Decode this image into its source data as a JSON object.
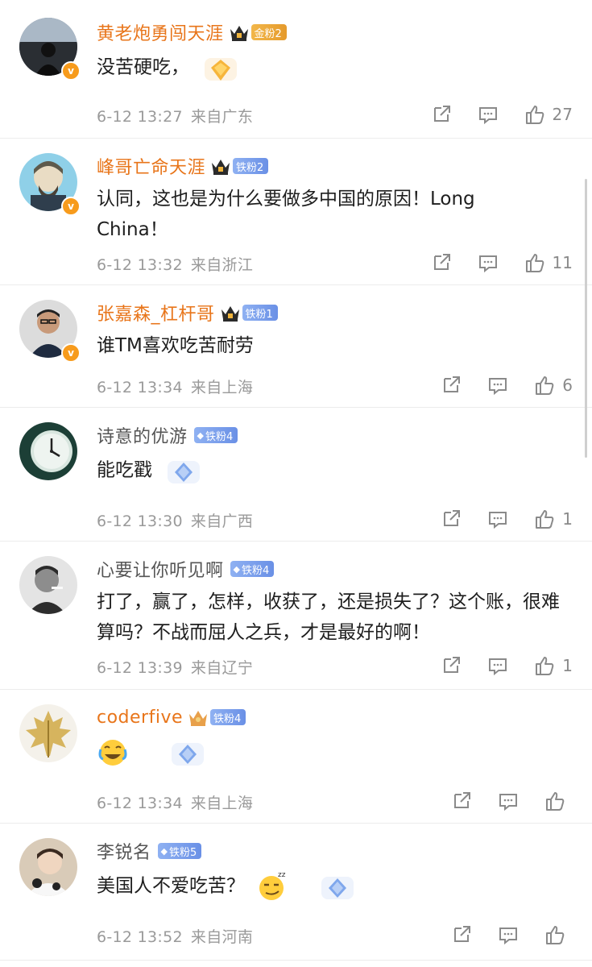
{
  "comments": [
    {
      "name": "黄老炮勇闯天涯",
      "name_color": "#e8751a",
      "fan_badge": "金粉2",
      "fan_badge_style": "gold",
      "text": "没苦硬吃，",
      "date": "6-12 13:27",
      "location": "来自广东",
      "likes": "27",
      "has_crown": true,
      "has_sticker": true
    },
    {
      "name": "峰哥亡命天涯",
      "name_color": "#e8751a",
      "fan_badge": "铁粉2",
      "fan_badge_style": "blue",
      "text": "认同，这也是为什么要做多中国的原因！Long China！",
      "date": "6-12 13:32",
      "location": "来自浙江",
      "likes": "11",
      "has_crown": true,
      "has_sticker": false
    },
    {
      "name": "张嘉森_杠杆哥",
      "name_color": "#e8751a",
      "fan_badge": "铁粉1",
      "fan_badge_style": "blue",
      "text": "谁TM喜欢吃苦耐劳",
      "date": "6-12 13:34",
      "location": "来自上海",
      "likes": "6",
      "has_crown": true,
      "has_sticker": false
    },
    {
      "name": "诗意的优游",
      "name_color": "#555555",
      "fan_badge": "铁粉4",
      "fan_badge_style": "blue",
      "text": "能吃戳",
      "date": "6-12 13:30",
      "location": "来自广西",
      "likes": "1",
      "has_crown": false,
      "has_sticker": true
    },
    {
      "name": "心要让你听见啊",
      "name_color": "#555555",
      "fan_badge": "铁粉4",
      "fan_badge_style": "blue",
      "text": "打了，赢了，怎样，收获了，还是损失了？这个账，很难算吗？不战而屈人之兵，才是最好的啊！",
      "date": "6-12 13:39",
      "location": "来自辽宁",
      "likes": "1",
      "has_crown": false,
      "has_sticker": false
    },
    {
      "name": "coderfive",
      "name_color": "#e8751a",
      "fan_badge": "铁粉4",
      "fan_badge_style": "blue",
      "text": "",
      "date": "6-12 13:34",
      "location": "来自上海",
      "likes": "",
      "has_crown": true,
      "has_sticker": true
    },
    {
      "name": "李锐名",
      "name_color": "#555555",
      "fan_badge": "铁粉5",
      "fan_badge_style": "blue",
      "text": "美国人不爱吃苦？",
      "date": "6-12 13:52",
      "location": "来自河南",
      "likes": "",
      "has_crown": false,
      "has_sticker": true
    }
  ],
  "icons": {
    "share": "share-icon",
    "comment": "comment-icon",
    "like": "thumbs-up-icon",
    "crown": "crown-icon",
    "verified": "verified-badge-icon",
    "diamond": "diamond-icon"
  },
  "colors": {
    "accent_orange": "#e8751a",
    "meta_gray": "#9a9a9a",
    "fan_blue": "#6a90e6",
    "fan_gold": "#e59a2c",
    "verified_orange": "#f79b1c"
  }
}
